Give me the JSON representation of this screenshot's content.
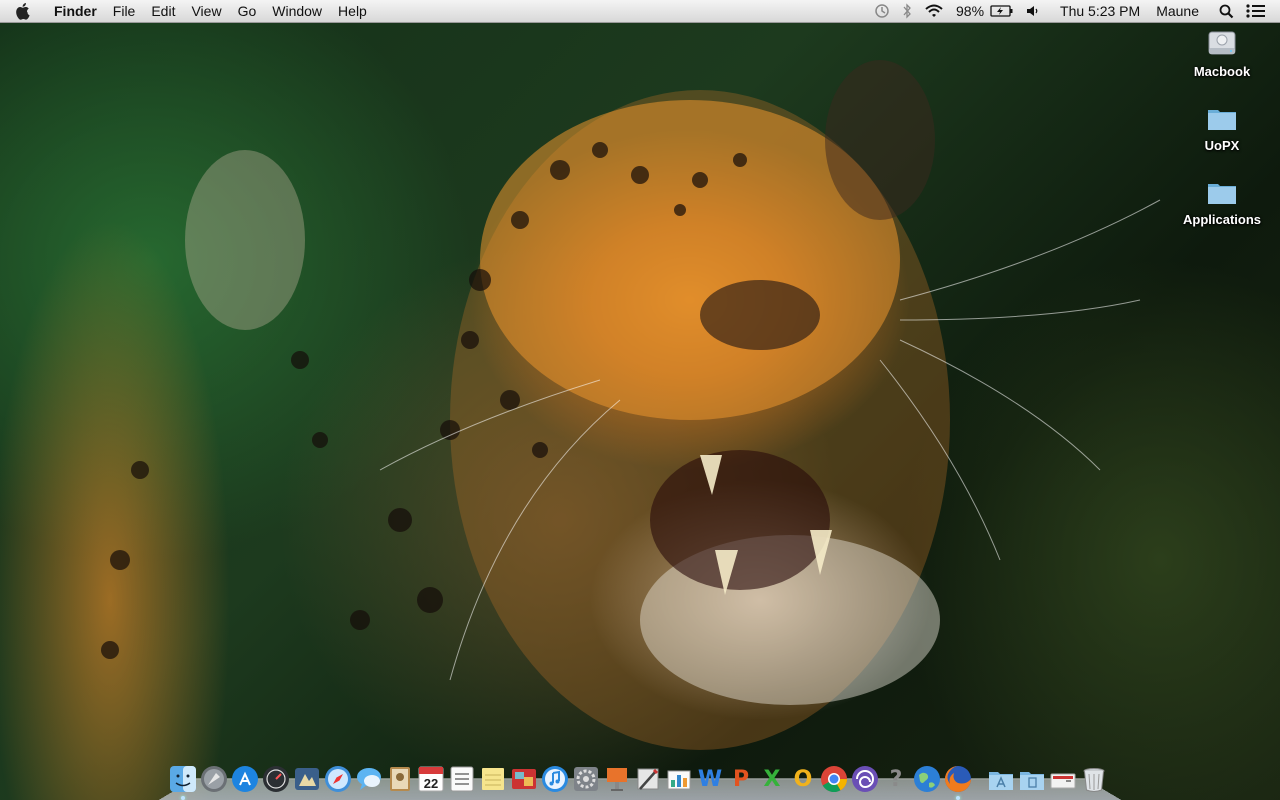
{
  "menubar": {
    "active_app": "Finder",
    "menus": [
      "File",
      "Edit",
      "View",
      "Go",
      "Window",
      "Help"
    ],
    "status": {
      "time_machine_icon": "time-machine-icon",
      "bluetooth_icon": "bluetooth-icon",
      "wifi_icon": "wifi-icon",
      "battery_percent": "98%",
      "battery_icon": "battery-charging-icon",
      "volume_icon": "volume-icon",
      "clock": "Thu 5:23 PM",
      "user": "Maune",
      "spotlight_icon": "spotlight-icon",
      "notifications_icon": "notification-center-icon"
    }
  },
  "desktop": {
    "icons": [
      {
        "label": "Macbook",
        "icon": "hard-drive-icon"
      },
      {
        "label": "UoPX",
        "icon": "folder-icon"
      },
      {
        "label": "Applications",
        "icon": "folder-icon"
      }
    ]
  },
  "dock": {
    "calendar_day": "22",
    "items": [
      {
        "icon": "finder-icon",
        "running": true
      },
      {
        "icon": "launchpad-icon"
      },
      {
        "icon": "app-store-icon"
      },
      {
        "icon": "dashboard-icon"
      },
      {
        "icon": "mission-control-icon"
      },
      {
        "icon": "safari-icon"
      },
      {
        "icon": "messages-icon"
      },
      {
        "icon": "contacts-icon"
      },
      {
        "icon": "calendar-icon"
      },
      {
        "icon": "reminders-icon"
      },
      {
        "icon": "notes-icon"
      },
      {
        "icon": "photo-booth-icon"
      },
      {
        "icon": "itunes-icon"
      },
      {
        "icon": "system-preferences-icon"
      },
      {
        "icon": "keynote-icon"
      },
      {
        "icon": "script-editor-icon"
      },
      {
        "icon": "numbers-icon"
      },
      {
        "icon": "word-icon",
        "glyph": "W",
        "color": "#2f7fe3"
      },
      {
        "icon": "powerpoint-icon",
        "glyph": "P",
        "color": "#e2531f"
      },
      {
        "icon": "excel-icon",
        "glyph": "X",
        "color": "#35b23a"
      },
      {
        "icon": "outlook-icon",
        "glyph": "O",
        "color": "#f1b21c"
      },
      {
        "icon": "chrome-icon"
      },
      {
        "icon": "spiral-app-icon"
      },
      {
        "icon": "help-icon",
        "glyph": "?",
        "color": "#8a8a8a"
      },
      {
        "icon": "globe-icon"
      },
      {
        "icon": "firefox-icon",
        "running": true
      }
    ],
    "stacks": [
      {
        "icon": "applications-stack-icon"
      },
      {
        "icon": "documents-stack-icon"
      },
      {
        "icon": "downloads-stack-icon"
      },
      {
        "icon": "trash-icon"
      }
    ]
  }
}
